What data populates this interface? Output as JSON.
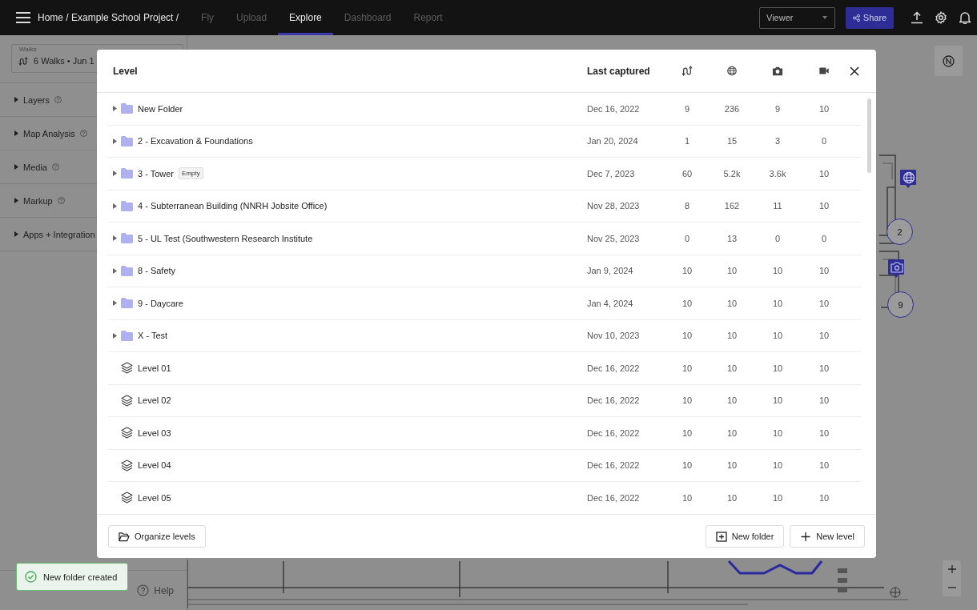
{
  "top_bar": {
    "breadcrumb": "Home / Example School Project /",
    "tabs": [
      {
        "label": "Fly",
        "selected": false
      },
      {
        "label": "Upload",
        "selected": false
      },
      {
        "label": "Explore",
        "selected": true
      },
      {
        "label": "Dashboard",
        "selected": false
      },
      {
        "label": "Report",
        "selected": false
      }
    ],
    "role_select": {
      "value": "Viewer"
    },
    "share_button": "Share"
  },
  "sidebar": {
    "walks": {
      "label": "Walks",
      "value": "6 Walks • Jun 1"
    },
    "sections": [
      {
        "label": "Layers",
        "expanded": false,
        "help_icon": true
      },
      {
        "label": "Map Analysis",
        "expanded": false,
        "help_icon": true
      },
      {
        "label": "Media",
        "expanded": false,
        "help_icon": true
      },
      {
        "label": "Markup",
        "expanded": false,
        "help_icon": true
      },
      {
        "label": "Apps + Integration",
        "expanded": false,
        "help_icon": false
      }
    ],
    "help": "Help"
  },
  "map": {
    "markers": [
      {
        "kind": "globe"
      },
      {
        "kind": "cluster",
        "count": "2"
      },
      {
        "kind": "camera"
      },
      {
        "kind": "cluster",
        "count": "9"
      }
    ]
  },
  "modal": {
    "columns": {
      "level": "Level",
      "last_captured": "Last captured"
    },
    "rows": [
      {
        "kind": "folder",
        "expanded": false,
        "name": "New Folder",
        "date": "Dec 16, 2022",
        "walks": "9",
        "panoramas": "236",
        "photos": "9",
        "videos": "10"
      },
      {
        "kind": "folder",
        "expanded": false,
        "name": "2 - Excavation & Foundations",
        "date": "Jan 20, 2024",
        "walks": "1",
        "panoramas": "15",
        "photos": "3",
        "videos": "0"
      },
      {
        "kind": "folder",
        "expanded": false,
        "name": "3 - Tower",
        "badge": "Empty",
        "date": "Dec 7, 2023",
        "walks": "60",
        "panoramas": "5.2k",
        "photos": "3.6k",
        "videos": "10"
      },
      {
        "kind": "folder",
        "expanded": false,
        "name": "4 - Subterranean Building (NNRH Jobsite Office)",
        "date": "Nov 28, 2023",
        "walks": "8",
        "panoramas": "162",
        "photos": "11",
        "videos": "10"
      },
      {
        "kind": "folder",
        "expanded": false,
        "name": "5 - UL Test (Southwestern Research Institute",
        "date": "Nov 25, 2023",
        "walks": "0",
        "panoramas": "13",
        "photos": "0",
        "videos": "0"
      },
      {
        "kind": "folder",
        "expanded": false,
        "name": "8 - Safety",
        "date": "Jan 9, 2024",
        "walks": "10",
        "panoramas": "10",
        "photos": "10",
        "videos": "10"
      },
      {
        "kind": "folder",
        "expanded": false,
        "name": "9 - Daycare",
        "date": "Jan 4, 2024",
        "walks": "10",
        "panoramas": "10",
        "photos": "10",
        "videos": "10"
      },
      {
        "kind": "folder",
        "expanded": false,
        "name": "X - Test",
        "date": "Nov 10, 2023",
        "walks": "10",
        "panoramas": "10",
        "photos": "10",
        "videos": "10"
      },
      {
        "kind": "level",
        "name": "Level 01",
        "date": "Dec 16, 2022",
        "walks": "10",
        "panoramas": "10",
        "photos": "10",
        "videos": "10"
      },
      {
        "kind": "level",
        "name": "Level 02",
        "date": "Dec 16, 2022",
        "walks": "10",
        "panoramas": "10",
        "photos": "10",
        "videos": "10"
      },
      {
        "kind": "level",
        "name": "Level 03",
        "date": "Dec 16, 2022",
        "walks": "10",
        "panoramas": "10",
        "photos": "10",
        "videos": "10"
      },
      {
        "kind": "level",
        "name": "Level 04",
        "date": "Dec 16, 2022",
        "walks": "10",
        "panoramas": "10",
        "photos": "10",
        "videos": "10"
      },
      {
        "kind": "level",
        "name": "Level 05",
        "date": "Dec 16, 2022",
        "walks": "10",
        "panoramas": "10",
        "photos": "10",
        "videos": "10"
      }
    ],
    "footer": {
      "organize_button": "Organize levels",
      "new_folder_button": "New folder",
      "new_level_button": "New level"
    }
  },
  "toast": {
    "message": "New folder created"
  }
}
